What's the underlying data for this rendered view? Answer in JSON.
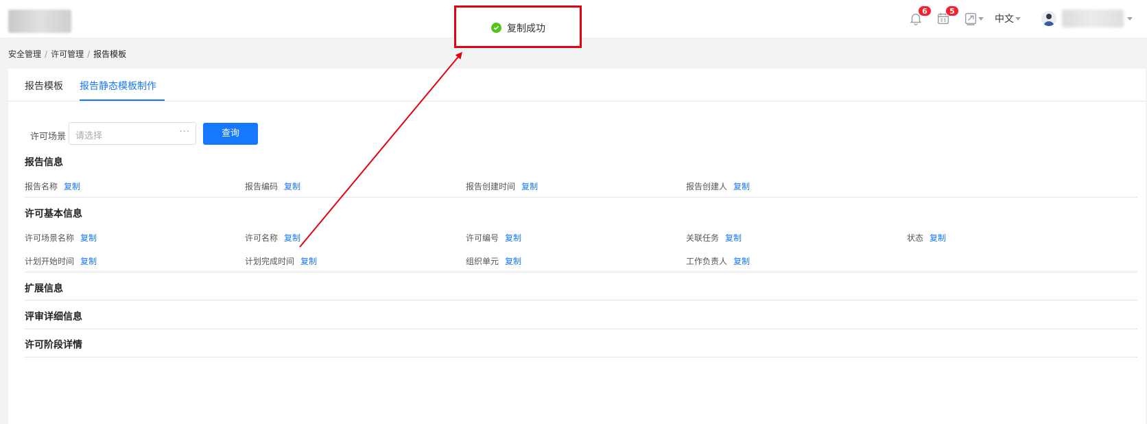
{
  "header": {
    "notifications_count": "6",
    "tasks_count": "5",
    "language": "中文"
  },
  "toast": {
    "message": "复制成功"
  },
  "breadcrumb": {
    "items": [
      "安全管理",
      "许可管理",
      "报告模板"
    ]
  },
  "tabs": [
    "报告模板",
    "报告静态模板制作"
  ],
  "filter": {
    "label": "许可场景",
    "placeholder": "请选择",
    "more": "···",
    "query_button": "查询"
  },
  "copy_label": "复制",
  "sections": {
    "report_info": {
      "title": "报告信息",
      "fields": [
        "报告名称",
        "报告编码",
        "报告创建时间",
        "报告创建人"
      ]
    },
    "permit_basic": {
      "title": "许可基本信息",
      "fields": [
        "许可场景名称",
        "许可名称",
        "许可编号",
        "关联任务",
        "状态",
        "计划开始时间",
        "计划完成时间",
        "组织单元",
        "工作负责人"
      ]
    },
    "extension": {
      "title": "扩展信息"
    },
    "review": {
      "title": "评审详细信息"
    },
    "stage": {
      "title": "许可阶段详情"
    }
  },
  "colors": {
    "primary": "#1677ff",
    "annotation": "#e5000f",
    "success": "#52c41a",
    "badge": "#f5222d"
  }
}
